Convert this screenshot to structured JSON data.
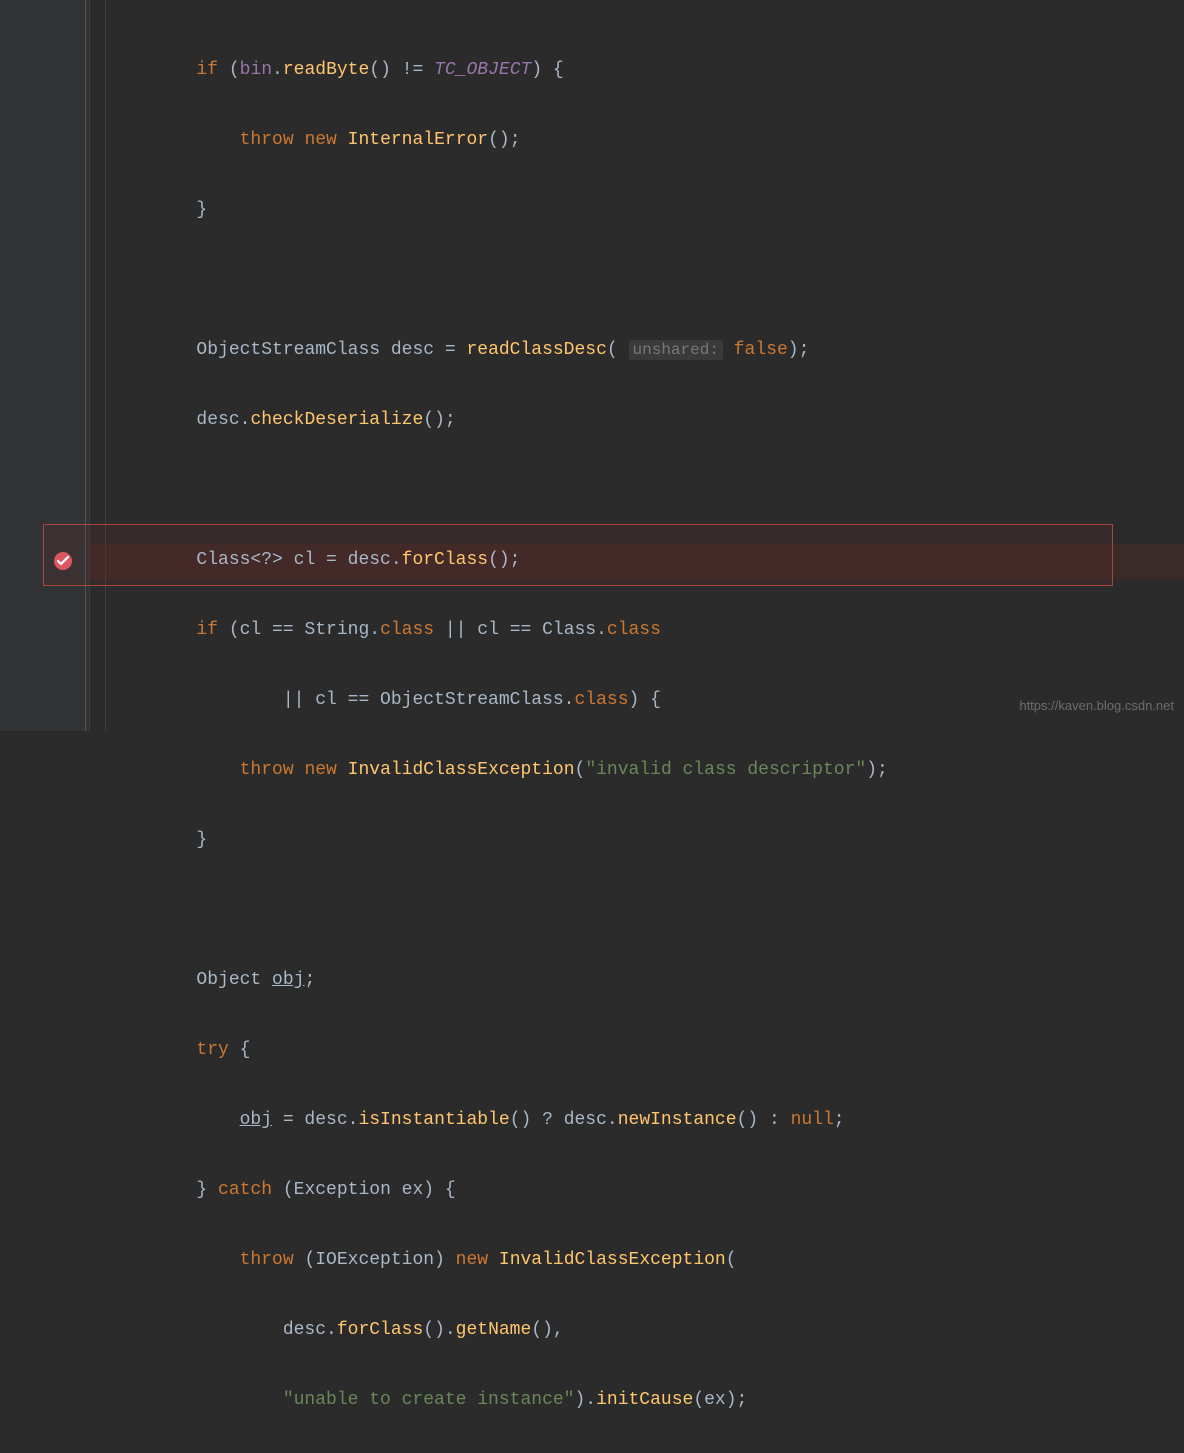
{
  "code": {
    "l1": {
      "kw_if": "if",
      "open": " (",
      "fld": "bin",
      "dot": ".",
      "mth": "readByte",
      "paren": "() != ",
      "con": "TC_OBJECT",
      "close": ") {"
    },
    "l2": {
      "kw_throw": "throw",
      "sp1": " ",
      "kw_new": "new",
      "sp2": " ",
      "mth": "InternalError",
      "end": "();"
    },
    "l3": {
      "brace": "}"
    },
    "l5": {
      "t1": "ObjectStreamClass desc = ",
      "mth": "readClassDesc",
      "open": "( ",
      "hint": "unshared:",
      "sp": " ",
      "kw": "false",
      "close": ");"
    },
    "l6": {
      "t1": "desc.",
      "mth": "checkDeserialize",
      "end": "();"
    },
    "l8": {
      "t1": "Class<?> cl = desc.",
      "mth": "forClass",
      "end": "();"
    },
    "l9": {
      "kw_if": "if",
      "t1": " (cl == String.",
      "kw_cls1": "class",
      "t2": " || cl == Class.",
      "kw_cls2": "class"
    },
    "l10": {
      "t1": "|| cl == ObjectStreamClass.",
      "kw_cls": "class",
      "t2": ") {"
    },
    "l11": {
      "kw_throw": "throw",
      "sp1": " ",
      "kw_new": "new",
      "sp2": " ",
      "mth": "InvalidClassException",
      "open": "(",
      "str": "\"invalid class descriptor\"",
      "close": ");"
    },
    "l12": {
      "brace": "}"
    },
    "l14": {
      "t1": "Object ",
      "var": "obj",
      "end": ";"
    },
    "l15": {
      "kw_try": "try",
      "brace": " {"
    },
    "l16": {
      "var": "obj",
      "t1": " = desc.",
      "mth1": "isInstantiable",
      "t2": "() ? desc.",
      "mth2": "newInstance",
      "t3": "() : ",
      "kw_null": "null",
      "end": ";"
    },
    "l17": {
      "brace": "} ",
      "kw_catch": "catch",
      "t1": " (Exception ex) {"
    },
    "l18": {
      "kw_throw": "throw",
      "t1": " (IOException) ",
      "kw_new": "new",
      "sp": " ",
      "mth": "InvalidClassException",
      "open": "("
    },
    "l19": {
      "t1": "desc.",
      "mth1": "forClass",
      "t2": "().",
      "mth2": "getName",
      "end": "(),"
    },
    "l20": {
      "str": "\"unable to create instance\"",
      "t1": ").",
      "mth": "initCause",
      "open": "(ex);"
    }
  },
  "watermark": "https://kaven.blog.csdn.net"
}
